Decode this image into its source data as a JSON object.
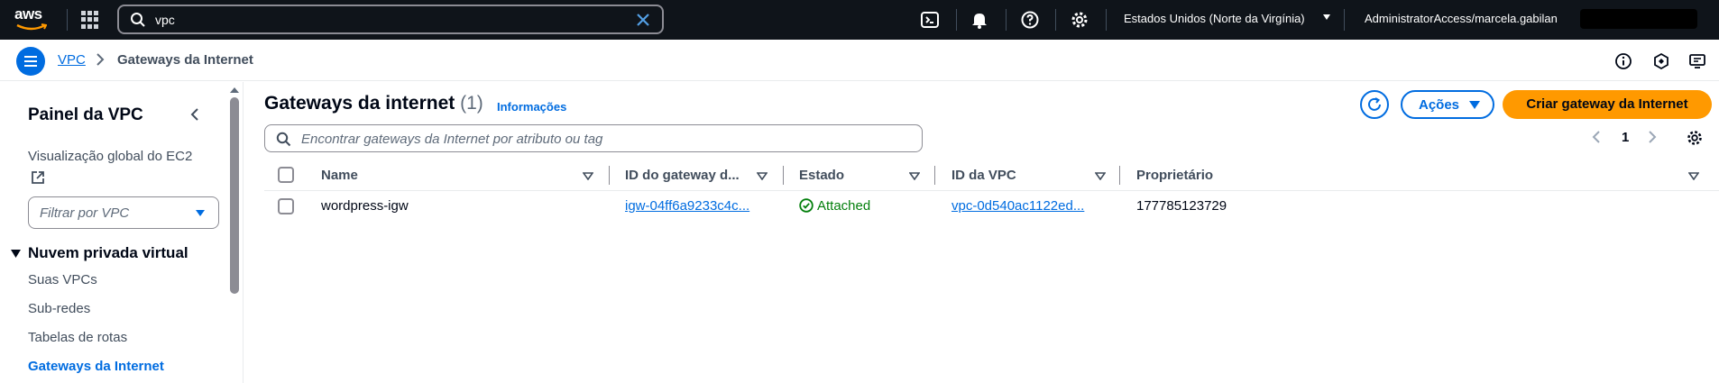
{
  "topnav": {
    "logo_text": "aws",
    "search_value": "vpc",
    "region": "Estados Unidos (Norte da Virgínia)",
    "account": "AdministratorAccess/marcela.gabilan"
  },
  "breadcrumb": {
    "root": "VPC",
    "current": "Gateways da Internet"
  },
  "sidebar": {
    "title": "Painel da VPC",
    "ec2_global": "Visualização global do EC2",
    "filter_placeholder": "Filtrar por VPC",
    "section": "Nuvem privada virtual",
    "items": [
      {
        "label": "Suas VPCs",
        "active": false
      },
      {
        "label": "Sub-redes",
        "active": false
      },
      {
        "label": "Tabelas de rotas",
        "active": false
      },
      {
        "label": "Gateways da Internet",
        "active": true
      }
    ]
  },
  "main": {
    "title": "Gateways da internet",
    "count": "(1)",
    "info": "Informações",
    "actions_label": "Ações",
    "create_label": "Criar gateway da Internet",
    "search_placeholder": "Encontrar gateways da Internet por atributo ou tag",
    "page": "1",
    "columns": [
      "Name",
      "ID do gateway d...",
      "Estado",
      "ID da VPC",
      "Proprietário"
    ],
    "rows": [
      {
        "name": "wordpress-igw",
        "gateway_id": "igw-04ff6a9233c4c...",
        "status": "Attached",
        "vpc_id": "vpc-0d540ac1122ed...",
        "owner": "177785123729"
      }
    ]
  },
  "colors": {
    "nav_bg": "#0f141a",
    "link": "#006ce0",
    "primary": "#ff9900",
    "success": "#037f0c"
  }
}
